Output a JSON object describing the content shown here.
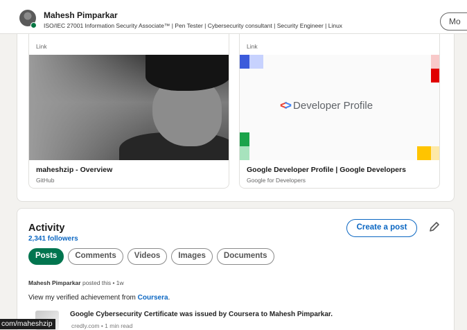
{
  "header": {
    "name": "Mahesh Pimparkar",
    "headline": "ISO/IEC 27001 Information Security Associate™ | Pen Tester | Cybersecurity consultant | Security Engineer | Linux",
    "more_label": "Mo"
  },
  "featured": {
    "cards": [
      {
        "type": "Link",
        "title": "maheshzip - Overview",
        "source": "GitHub",
        "image": "profile-photo"
      },
      {
        "type": "Link",
        "title": "Google Developer Profile | Google Developers",
        "source": "Google for Developers",
        "image": "developer-profile-graphic",
        "graphic_text": "Developer Profile"
      }
    ]
  },
  "activity": {
    "title": "Activity",
    "followers": "2,341 followers",
    "create_post_label": "Create a post",
    "filters": [
      "Posts",
      "Comments",
      "Videos",
      "Images",
      "Documents"
    ],
    "active_filter": "Posts",
    "post": {
      "author": "Mahesh Pimparkar",
      "meta_suffix": "posted this • 1w",
      "text_prefix": "View my verified achievement from ",
      "text_link": "Coursera",
      "text_suffix": ".",
      "attachment_title": "Google Cybersecurity Certificate was issued by Coursera to Mahesh Pimparkar.",
      "attachment_source": "credly.com • 1 min read"
    }
  },
  "status_bar": {
    "url_fragment": "com/maheshzip"
  },
  "colors": {
    "brand_blue": "#0a66c2",
    "active_green": "#01754f",
    "online_green": "#057642"
  }
}
